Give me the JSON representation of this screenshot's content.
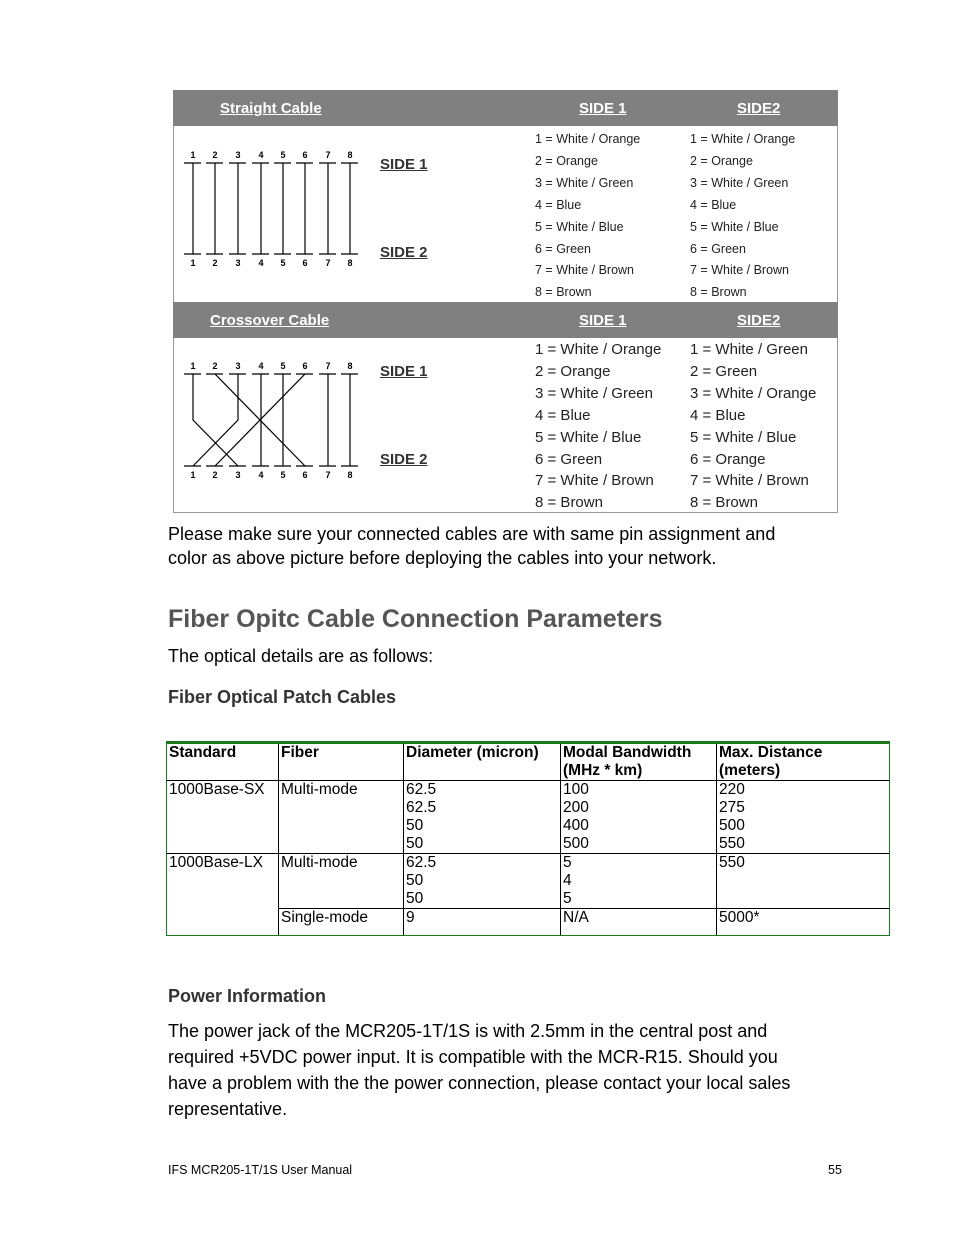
{
  "straight": {
    "title": "Straight Cable",
    "side1_header": "SIDE 1",
    "side2_header": "SIDE2",
    "diagram_side1": "SIDE 1",
    "diagram_side2": "SIDE 2",
    "pins_top": [
      "1",
      "2",
      "3",
      "4",
      "5",
      "6",
      "7",
      "8"
    ],
    "pins_bottom": [
      "1",
      "2",
      "3",
      "4",
      "5",
      "6",
      "7",
      "8"
    ],
    "side1": [
      "1 = White / Orange",
      "2 = Orange",
      "3 = White / Green",
      "4 = Blue",
      "5 = White / Blue",
      "6 = Green",
      "7 = White / Brown",
      "8 = Brown"
    ],
    "side2": [
      "1 = White / Orange",
      "2 = Orange",
      "3 = White / Green",
      "4 = Blue",
      "5 = White / Blue",
      "6 = Green",
      "7 = White / Brown",
      "8 = Brown"
    ]
  },
  "crossover": {
    "title": "Crossover Cable",
    "side1_header": "SIDE 1",
    "side2_header": "SIDE2",
    "diagram_side1": "SIDE 1",
    "diagram_side2": "SIDE 2",
    "pins_top": [
      "1",
      "2",
      "3",
      "4",
      "5",
      "6",
      "7",
      "8"
    ],
    "pins_bottom": [
      "1",
      "2",
      "3",
      "4",
      "5",
      "6",
      "7",
      "8"
    ],
    "wiring": [
      [
        1,
        3
      ],
      [
        2,
        6
      ],
      [
        3,
        1
      ],
      [
        4,
        4
      ],
      [
        5,
        5
      ],
      [
        6,
        2
      ],
      [
        7,
        7
      ],
      [
        8,
        8
      ]
    ],
    "side1": [
      "1 = White / Orange",
      "2 = Orange",
      "3 = White / Green",
      "4 = Blue",
      "5 = White / Blue",
      "6 = Green",
      "7 = White / Brown",
      "8 = Brown"
    ],
    "side2": [
      "1 = White / Green",
      "2 = Green",
      "3 = White / Orange",
      "4 = Blue",
      "5 = White / Blue",
      "6 = Orange",
      "7 = White / Brown",
      "8 = Brown"
    ]
  },
  "note": [
    "Please make sure your connected cables are with same pin assignment and",
    "color as above picture before deploying the cables into your network."
  ],
  "section_title": "Fiber Opitc Cable Connection Parameters",
  "intro": "The optical details are as follows:",
  "fiber_heading": "Fiber Optical Patch Cables",
  "fiber_table": {
    "headers": [
      "Standard",
      "Fiber",
      "Diameter (micron)",
      "Modal Bandwidth (MHz * km)",
      "Max. Distance (meters)"
    ],
    "rows": [
      {
        "standard": "1000Base-SX",
        "fiber": "Multi-mode",
        "diameter": [
          "62.5",
          "62.5",
          "50",
          "50"
        ],
        "bandwidth": [
          "100",
          "200",
          "400",
          "500"
        ],
        "distance": [
          "220",
          "275",
          "500",
          "550"
        ]
      },
      {
        "standard": "1000Base-LX",
        "fiber": "Multi-mode",
        "diameter": [
          "62.5",
          "50",
          "50"
        ],
        "bandwidth": [
          "5",
          "4",
          "5"
        ],
        "distance": [
          "550"
        ]
      },
      {
        "standard": "",
        "fiber": "Single-mode",
        "diameter": [
          "9"
        ],
        "bandwidth": [
          "N/A"
        ],
        "distance": [
          "5000*"
        ]
      }
    ]
  },
  "power_heading": "Power Information",
  "power_text": [
    "The power jack of the MCR205-1T/1S is with 2.5mm in the central post and",
    "required +5VDC power input. It is compatible with the MCR-R15. Should you",
    "have a problem with the the power connection, please contact your local sales",
    "representative."
  ],
  "footer": {
    "left": "IFS MCR205-1T/1S User Manual",
    "page": "55"
  }
}
